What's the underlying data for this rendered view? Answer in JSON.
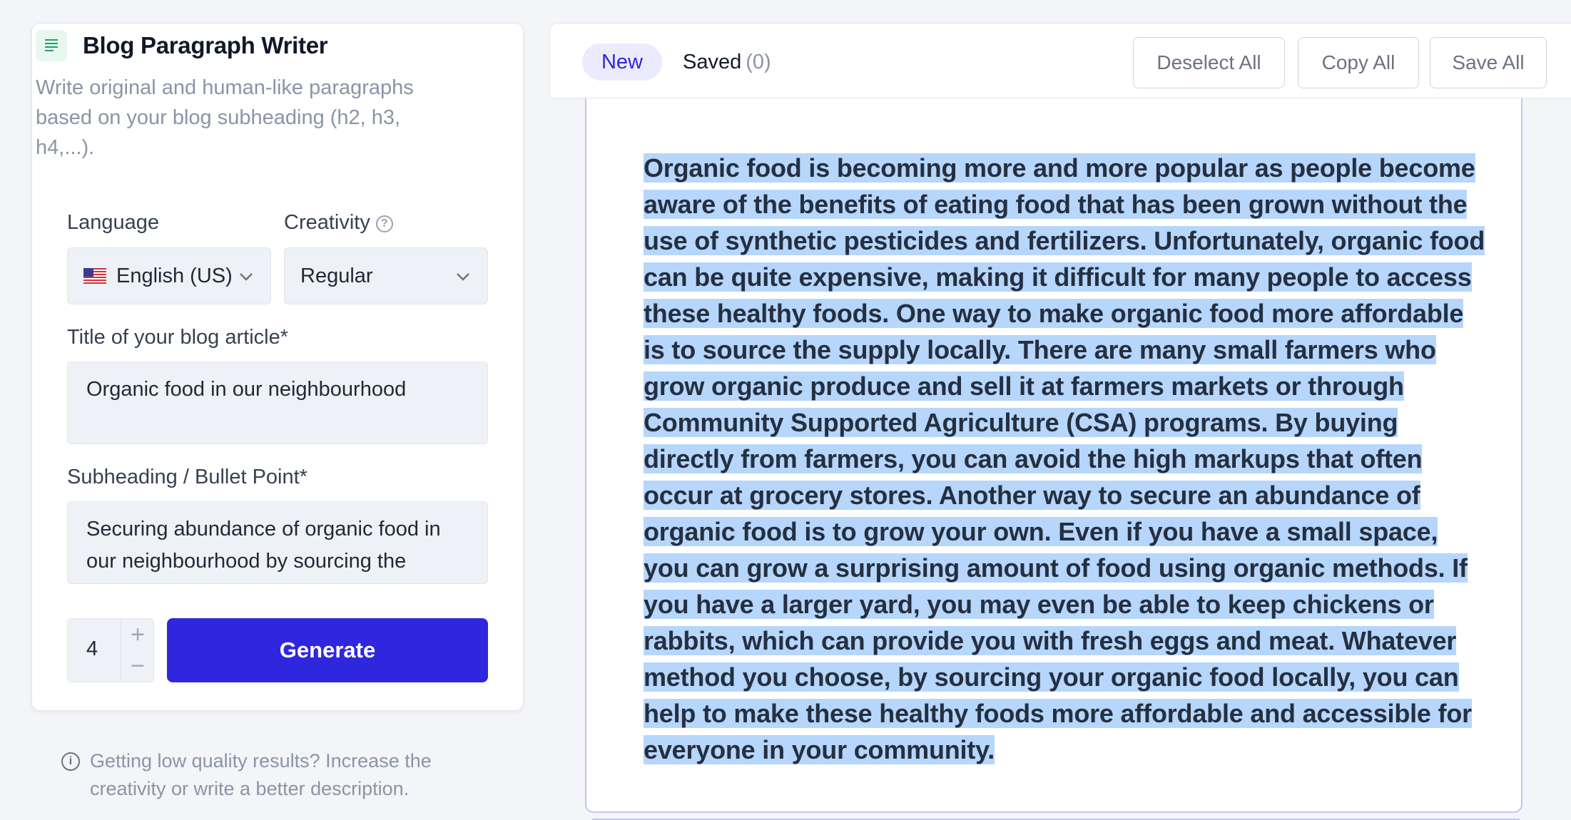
{
  "tool": {
    "title": "Blog Paragraph Writer",
    "description": "Write original and human-like paragraphs based on your blog subheading (h2, h3, h4,...).",
    "icon": "document-lines-icon"
  },
  "language": {
    "label": "Language",
    "value": "English (US)",
    "flag": "us-flag-icon"
  },
  "creativity": {
    "label": "Creativity",
    "value": "Regular"
  },
  "title_field": {
    "label": "Title of your blog article*",
    "value": "Organic food in our neighbourhood"
  },
  "subheading_field": {
    "label": "Subheading / Bullet Point*",
    "value": "Securing abundance of organic food in our neighbourhood by sourcing the supply locally"
  },
  "quantity": {
    "value": "4",
    "plus": "+",
    "minus": "−"
  },
  "generate_label": "Generate",
  "tip": "Getting low quality results? Increase the creativity or write a better description.",
  "tabs": {
    "new_label": "New",
    "saved_label": "Saved",
    "saved_count": "(0)"
  },
  "actions": {
    "deselect_all": "Deselect All",
    "copy_all": "Copy All",
    "save_all": "Save All"
  },
  "result": {
    "text": "Organic food is becoming more and more popular as people become aware of the benefits of eating food that has been grown without the use of synthetic pesticides and fertilizers. Unfortunately, organic food can be quite expensive, making it difficult for many people to access these healthy foods. One way to make organic food more affordable is to source the supply locally. There are many small farmers who grow organic produce and sell it at farmers markets or through Community Supported Agriculture (CSA) programs. By buying directly from farmers, you can avoid the high markups that often occur at grocery stores. Another way to secure an abundance of organic food is to grow your own. Even if you have a small space, you can grow a surprising amount of food using organic methods. If you have a larger yard, you may even be able to keep chickens or rabbits, which can provide you with fresh eggs and meat. Whatever method you choose, by sourcing your organic food locally, you can help to make these healthy foods more affordable and accessible for everyone in your community."
  },
  "colors": {
    "accent": "#2f27dd",
    "selection": "#b6d6fb",
    "card_border": "#c6c2f2"
  }
}
